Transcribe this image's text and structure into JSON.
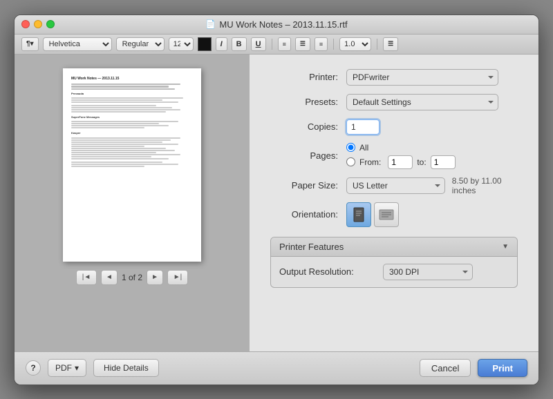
{
  "window": {
    "title": "MU Work Notes – 2013.11.15.rtf",
    "doc_icon": "📄"
  },
  "toolbar": {
    "font": "Helvetica",
    "style": "Regular",
    "size": "12",
    "bold": "B",
    "italic": "I",
    "underline": "U",
    "spacing": "1.0"
  },
  "print": {
    "printer_label": "Printer:",
    "printer_value": "PDFwriter",
    "presets_label": "Presets:",
    "presets_value": "Default Settings",
    "copies_label": "Copies:",
    "copies_value": "1",
    "pages_label": "Pages:",
    "pages_all": "All",
    "pages_from": "From:",
    "pages_from_value": "1",
    "pages_to": "to:",
    "pages_to_value": "1",
    "paper_size_label": "Paper Size:",
    "paper_size_value": "US Letter",
    "paper_size_info": "8.50 by 11.00 inches",
    "orientation_label": "Orientation:",
    "features_title": "Printer Features",
    "output_resolution_label": "Output Resolution:",
    "output_resolution_value": "300 DPI"
  },
  "page_nav": {
    "page_indicator": "1 of 2"
  },
  "bottom": {
    "help": "?",
    "pdf": "PDF",
    "pdf_arrow": "▾",
    "hide_details": "Hide Details",
    "cancel": "Cancel",
    "print": "Print"
  }
}
